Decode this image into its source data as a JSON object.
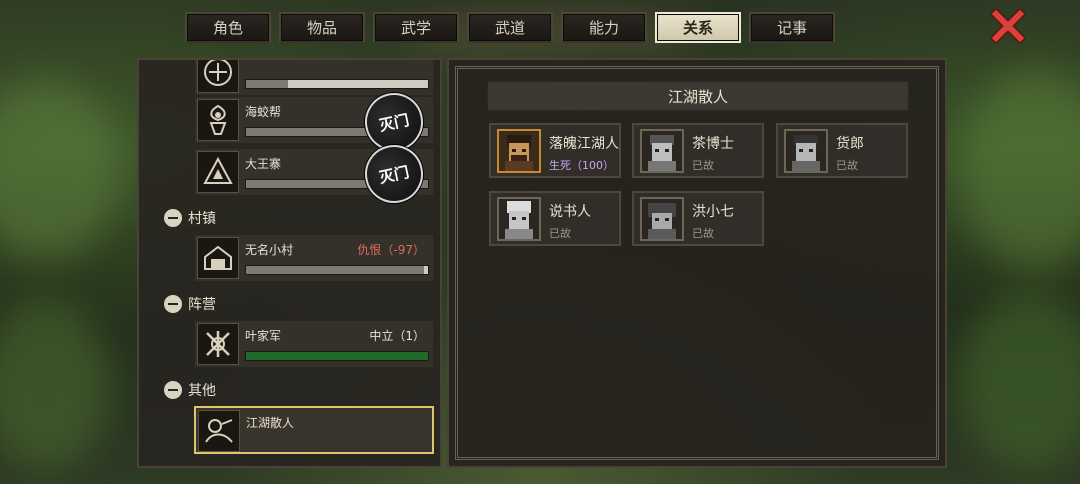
{
  "tabs": [
    "角色",
    "物品",
    "武学",
    "武道",
    "能力",
    "关系",
    "记事"
  ],
  "active_tab": "关系",
  "left": {
    "top_row": {
      "fill": 0.23
    },
    "sect_rows": [
      {
        "name": "海蛟帮",
        "seal": "灭门"
      },
      {
        "name": "大王寨",
        "seal": "灭门"
      }
    ],
    "categories": {
      "village": {
        "label": "村镇",
        "rows": [
          {
            "name": "无名小村",
            "relation": "仇恨（-97）",
            "fill": 0.98
          }
        ]
      },
      "faction": {
        "label": "阵营",
        "rows": [
          {
            "name": "叶家军",
            "relation": "中立（1）",
            "fill": 1.0
          }
        ]
      },
      "other": {
        "label": "其他",
        "rows": [
          {
            "name": "江湖散人"
          }
        ]
      }
    }
  },
  "right": {
    "group_title": "江湖散人",
    "people": [
      {
        "name": "落魄江湖人",
        "status": "生死（100）"
      },
      {
        "name": "茶博士",
        "status": "已故"
      },
      {
        "name": "货郎",
        "status": "已故"
      },
      {
        "name": "说书人",
        "status": "已故"
      },
      {
        "name": "洪小七",
        "status": "已故"
      }
    ]
  },
  "colors": {
    "hate": "#e06a5c",
    "neutral": "#e8e2d0",
    "alive": "#c9a6f0",
    "dead": "#9d978a",
    "accent": "#e2c46a",
    "close": "#d9423a",
    "bar_green": "#1f6b2a",
    "bar_gray": "#7d7a74"
  },
  "icons": {
    "close": "close-icon",
    "minus": "collapse-icon",
    "seal": "destroyed-seal-icon"
  }
}
